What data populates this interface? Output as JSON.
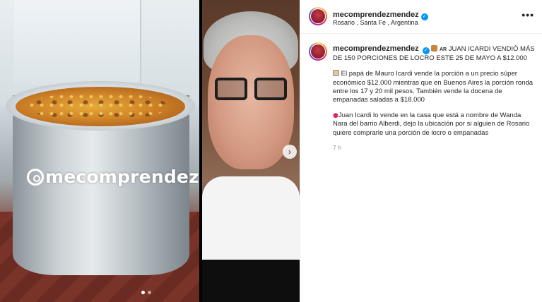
{
  "media": {
    "watermark": "mecomprendezmendez",
    "carousel_count": 2,
    "carousel_active": 1
  },
  "post": {
    "author": "mecomprendezmendez",
    "verified": true,
    "location": "Rosario , Santa Fe , Argentina",
    "more_label": "•••",
    "next_label": "›",
    "caption_flag": "AR",
    "caption_title": "JUAN ICARDI VENDIÓ MÁS DE 150 PORCIONES DE LOCRO ESTE 25 DE MAYO A $12.000",
    "paragraph_1": "El papá de Mauro Icardi vende la porción a un precio súper económico $12.000 mientras que en Buenos Aires la porción ronda entre los 17 y 20 mil pesos. También vende la docena de empanadas saladas a $18.000",
    "paragraph_2": "Juan Icardi lo vende en la casa que está a nombre de Wanda Nara del barrio Alberdi, dejo la ubicación por si alguien de Rosario quiere comprarle una porción de locro o empanadas",
    "time": "7 h"
  },
  "icons": [
    "verified-badge-icon",
    "more-options-icon",
    "chevron-right-icon",
    "stew-emoji-icon",
    "paper-emoji-icon",
    "pin-emoji-icon"
  ],
  "colors": {
    "verified": "#0095f6",
    "muted_text": "#8e8e8e",
    "text": "#262626"
  }
}
